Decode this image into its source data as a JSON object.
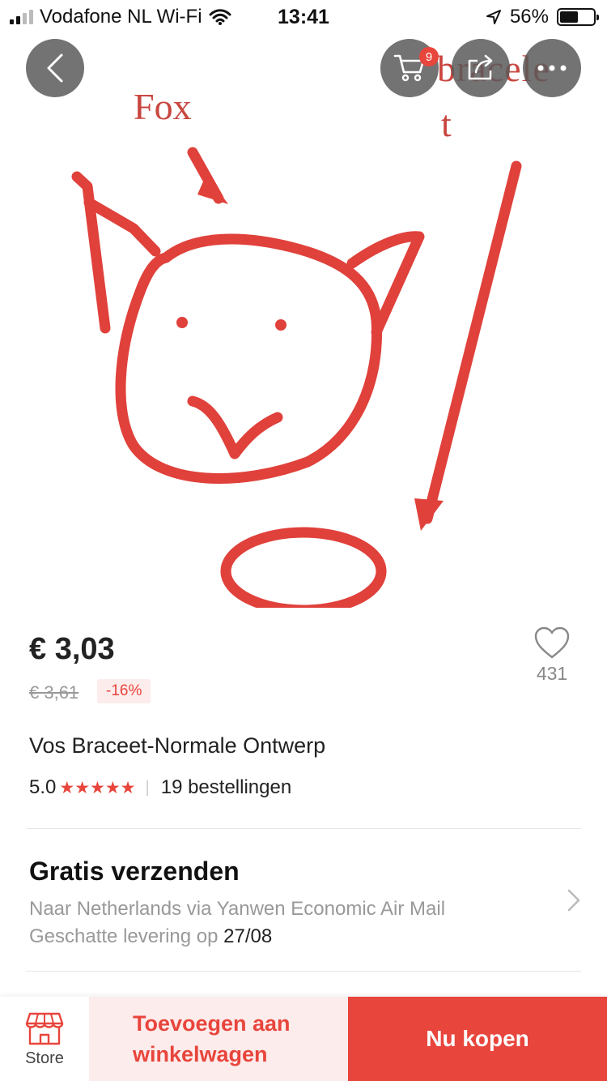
{
  "status_bar": {
    "carrier": "Vodafone NL Wi-Fi",
    "time": "13:41",
    "battery_percent": "56%",
    "battery_level": 0.56
  },
  "header": {
    "cart_badge": "9"
  },
  "product_image": {
    "label_fox": "Fox",
    "label_bracelet_1": "bracele",
    "label_bracelet_2": "t"
  },
  "product": {
    "price": "€ 3,03",
    "old_price": "€ 3,61",
    "discount": "-16%",
    "wishlist_count": "431",
    "title": "Vos Braceet-Normale Ontwerp",
    "rating": "5.0",
    "stars": "★★★★★",
    "rating_stars": 5,
    "orders": "19 bestellingen"
  },
  "shipping": {
    "title": "Gratis verzenden",
    "route": "Naar Netherlands via Yanwen Economic Air Mail",
    "delivery_prefix": "Geschatte levering op",
    "delivery_date": "27/08"
  },
  "bottom_bar": {
    "store_label": "Store",
    "add_to_cart_line1": "Toevoegen aan",
    "add_to_cart_line2": "winkelwagen",
    "buy_now": "Nu kopen"
  },
  "colors": {
    "accent": "#e8453c",
    "accent_light": "#fdecec"
  }
}
